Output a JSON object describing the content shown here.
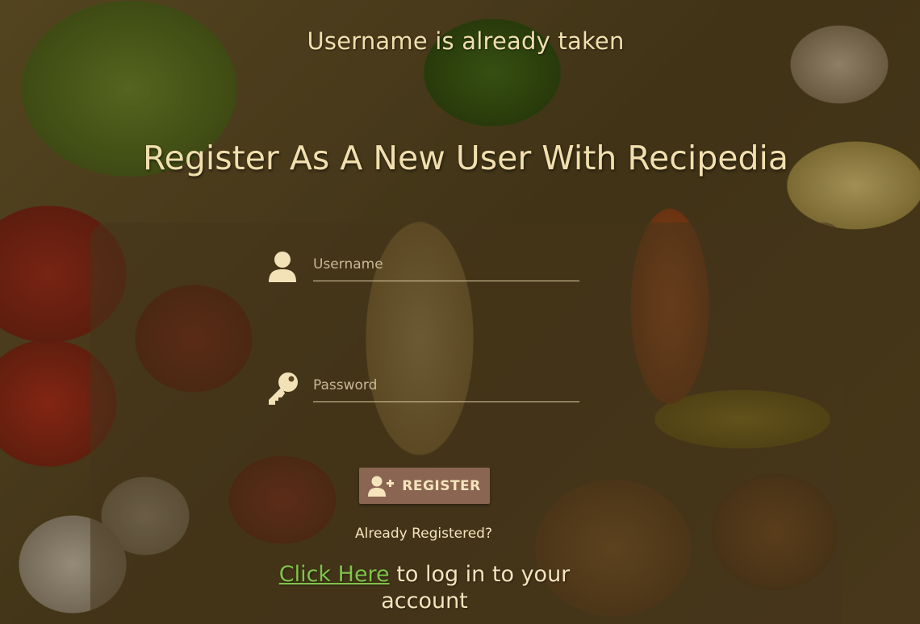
{
  "flash": {
    "message": "Username is already taken"
  },
  "header": {
    "title": "Register As A New User With Recipedia"
  },
  "form": {
    "username": {
      "placeholder": "Username",
      "value": "",
      "icon": "user-icon"
    },
    "password": {
      "placeholder": "Password",
      "value": "",
      "icon": "key-icon"
    },
    "register_button": {
      "label": "REGISTER",
      "icon": "user-plus-icon"
    }
  },
  "login": {
    "already_registered": "Already Registered?",
    "link_text": "Click Here",
    "rest_text": " to log in to your account"
  },
  "colors": {
    "text": "#f1dfae",
    "link": "#7fc44a",
    "button": "#8a6552"
  }
}
